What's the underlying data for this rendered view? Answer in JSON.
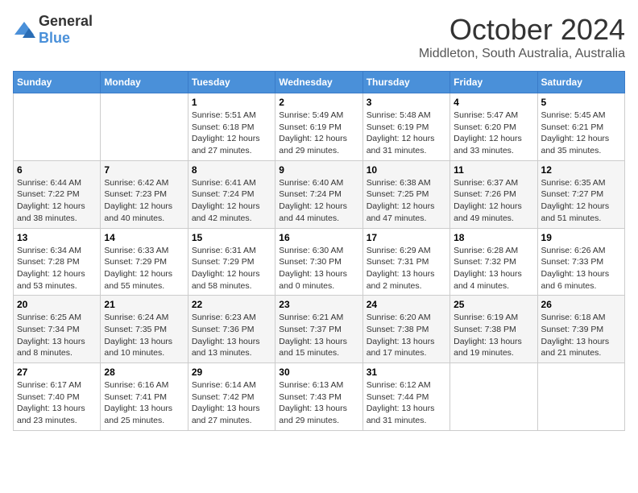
{
  "header": {
    "logo_general": "General",
    "logo_blue": "Blue",
    "month_title": "October 2024",
    "location": "Middleton, South Australia, Australia"
  },
  "weekdays": [
    "Sunday",
    "Monday",
    "Tuesday",
    "Wednesday",
    "Thursday",
    "Friday",
    "Saturday"
  ],
  "weeks": [
    [
      {
        "day": "",
        "info": ""
      },
      {
        "day": "",
        "info": ""
      },
      {
        "day": "1",
        "info": "Sunrise: 5:51 AM\nSunset: 6:18 PM\nDaylight: 12 hours and 27 minutes."
      },
      {
        "day": "2",
        "info": "Sunrise: 5:49 AM\nSunset: 6:19 PM\nDaylight: 12 hours and 29 minutes."
      },
      {
        "day": "3",
        "info": "Sunrise: 5:48 AM\nSunset: 6:19 PM\nDaylight: 12 hours and 31 minutes."
      },
      {
        "day": "4",
        "info": "Sunrise: 5:47 AM\nSunset: 6:20 PM\nDaylight: 12 hours and 33 minutes."
      },
      {
        "day": "5",
        "info": "Sunrise: 5:45 AM\nSunset: 6:21 PM\nDaylight: 12 hours and 35 minutes."
      }
    ],
    [
      {
        "day": "6",
        "info": "Sunrise: 6:44 AM\nSunset: 7:22 PM\nDaylight: 12 hours and 38 minutes."
      },
      {
        "day": "7",
        "info": "Sunrise: 6:42 AM\nSunset: 7:23 PM\nDaylight: 12 hours and 40 minutes."
      },
      {
        "day": "8",
        "info": "Sunrise: 6:41 AM\nSunset: 7:24 PM\nDaylight: 12 hours and 42 minutes."
      },
      {
        "day": "9",
        "info": "Sunrise: 6:40 AM\nSunset: 7:24 PM\nDaylight: 12 hours and 44 minutes."
      },
      {
        "day": "10",
        "info": "Sunrise: 6:38 AM\nSunset: 7:25 PM\nDaylight: 12 hours and 47 minutes."
      },
      {
        "day": "11",
        "info": "Sunrise: 6:37 AM\nSunset: 7:26 PM\nDaylight: 12 hours and 49 minutes."
      },
      {
        "day": "12",
        "info": "Sunrise: 6:35 AM\nSunset: 7:27 PM\nDaylight: 12 hours and 51 minutes."
      }
    ],
    [
      {
        "day": "13",
        "info": "Sunrise: 6:34 AM\nSunset: 7:28 PM\nDaylight: 12 hours and 53 minutes."
      },
      {
        "day": "14",
        "info": "Sunrise: 6:33 AM\nSunset: 7:29 PM\nDaylight: 12 hours and 55 minutes."
      },
      {
        "day": "15",
        "info": "Sunrise: 6:31 AM\nSunset: 7:29 PM\nDaylight: 12 hours and 58 minutes."
      },
      {
        "day": "16",
        "info": "Sunrise: 6:30 AM\nSunset: 7:30 PM\nDaylight: 13 hours and 0 minutes."
      },
      {
        "day": "17",
        "info": "Sunrise: 6:29 AM\nSunset: 7:31 PM\nDaylight: 13 hours and 2 minutes."
      },
      {
        "day": "18",
        "info": "Sunrise: 6:28 AM\nSunset: 7:32 PM\nDaylight: 13 hours and 4 minutes."
      },
      {
        "day": "19",
        "info": "Sunrise: 6:26 AM\nSunset: 7:33 PM\nDaylight: 13 hours and 6 minutes."
      }
    ],
    [
      {
        "day": "20",
        "info": "Sunrise: 6:25 AM\nSunset: 7:34 PM\nDaylight: 13 hours and 8 minutes."
      },
      {
        "day": "21",
        "info": "Sunrise: 6:24 AM\nSunset: 7:35 PM\nDaylight: 13 hours and 10 minutes."
      },
      {
        "day": "22",
        "info": "Sunrise: 6:23 AM\nSunset: 7:36 PM\nDaylight: 13 hours and 13 minutes."
      },
      {
        "day": "23",
        "info": "Sunrise: 6:21 AM\nSunset: 7:37 PM\nDaylight: 13 hours and 15 minutes."
      },
      {
        "day": "24",
        "info": "Sunrise: 6:20 AM\nSunset: 7:38 PM\nDaylight: 13 hours and 17 minutes."
      },
      {
        "day": "25",
        "info": "Sunrise: 6:19 AM\nSunset: 7:38 PM\nDaylight: 13 hours and 19 minutes."
      },
      {
        "day": "26",
        "info": "Sunrise: 6:18 AM\nSunset: 7:39 PM\nDaylight: 13 hours and 21 minutes."
      }
    ],
    [
      {
        "day": "27",
        "info": "Sunrise: 6:17 AM\nSunset: 7:40 PM\nDaylight: 13 hours and 23 minutes."
      },
      {
        "day": "28",
        "info": "Sunrise: 6:16 AM\nSunset: 7:41 PM\nDaylight: 13 hours and 25 minutes."
      },
      {
        "day": "29",
        "info": "Sunrise: 6:14 AM\nSunset: 7:42 PM\nDaylight: 13 hours and 27 minutes."
      },
      {
        "day": "30",
        "info": "Sunrise: 6:13 AM\nSunset: 7:43 PM\nDaylight: 13 hours and 29 minutes."
      },
      {
        "day": "31",
        "info": "Sunrise: 6:12 AM\nSunset: 7:44 PM\nDaylight: 13 hours and 31 minutes."
      },
      {
        "day": "",
        "info": ""
      },
      {
        "day": "",
        "info": ""
      }
    ]
  ]
}
